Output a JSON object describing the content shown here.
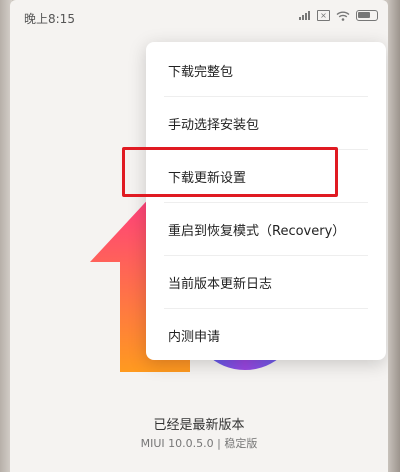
{
  "status_bar": {
    "time": "晚上8:15",
    "icons": [
      "signal-icon",
      "sim-x-icon",
      "wifi-icon",
      "battery-icon"
    ],
    "battery_level": 0.7
  },
  "menu": {
    "items": [
      {
        "label": "下载完整包"
      },
      {
        "label": "手动选择安装包"
      },
      {
        "label": "下载更新设置"
      },
      {
        "label": "重启到恢复模式（Recovery）"
      },
      {
        "label": "当前版本更新日志"
      },
      {
        "label": "内测申请"
      }
    ],
    "highlighted_item": "下载更新设置",
    "highlight_color": "#e01a22"
  },
  "update_status": {
    "title": "已经是最新版本",
    "version": "MIUI 10.0.5.0 | 稳定版"
  },
  "colors": {
    "arrow_top": "#ff3d7f",
    "arrow_bottom": "#ff9a1f",
    "circle": "#5a5cf0"
  }
}
